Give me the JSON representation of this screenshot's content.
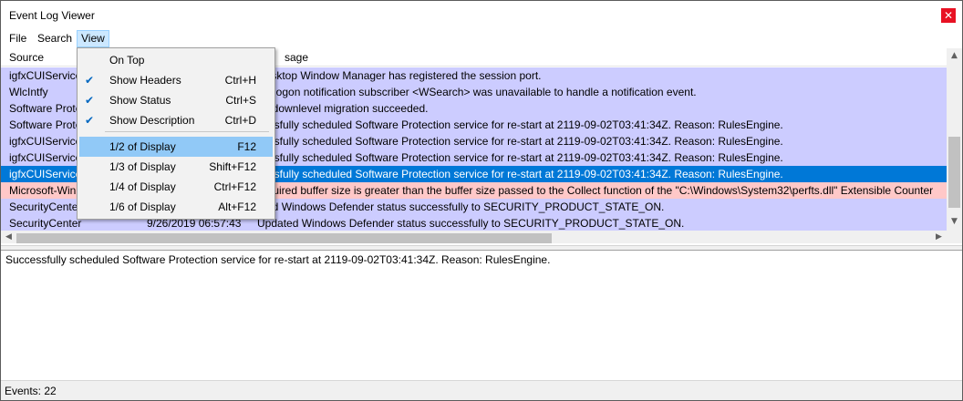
{
  "window": {
    "title": "Event Log Viewer",
    "close_glyph": "✕"
  },
  "menubar": {
    "file": "File",
    "search": "Search",
    "view": "View"
  },
  "columns": {
    "source": "Source",
    "message_partial": "sage"
  },
  "colors": {
    "row_normal": "#ccccff",
    "row_selected": "#0078d7",
    "row_error": "#ffc8c8",
    "row_text_selected": "#ffffff"
  },
  "rows": [
    {
      "source": "igfxCUIService",
      "time": "",
      "message": "Desktop Window Manager has registered the session port.",
      "kind": "normal"
    },
    {
      "source": "WlcIntfy",
      "time": "",
      "message": "winlogon notification subscriber <WSearch> was unavailable to handle a notification event.",
      "kind": "normal"
    },
    {
      "source": "Software Prote",
      "time": "",
      "message": "ne downlevel migration succeeded.",
      "kind": "normal"
    },
    {
      "source": "Software Prote",
      "time": "",
      "message": "cessfully scheduled Software Protection service for re-start at 2119-09-02T03:41:34Z. Reason: RulesEngine.",
      "kind": "normal"
    },
    {
      "source": "igfxCUIService",
      "time": "",
      "message": "cessfully scheduled Software Protection service for re-start at 2119-09-02T03:41:34Z. Reason: RulesEngine.",
      "kind": "normal"
    },
    {
      "source": "igfxCUIService",
      "time": "",
      "message": "cessfully scheduled Software Protection service for re-start at 2119-09-02T03:41:34Z. Reason: RulesEngine.",
      "kind": "normal"
    },
    {
      "source": "igfxCUIService",
      "time": "",
      "message": "cessfully scheduled Software Protection service for re-start at 2119-09-02T03:41:34Z. Reason: RulesEngine.",
      "kind": "selected"
    },
    {
      "source": "Microsoft-Win",
      "time": "",
      "message": "required buffer size is greater than the buffer size passed to the Collect function of the \"C:\\Windows\\System32\\perfts.dll\" Extensible Counter",
      "kind": "error"
    },
    {
      "source": "SecurityCenter",
      "time": "",
      "message": "ated Windows Defender status successfully to SECURITY_PRODUCT_STATE_ON.",
      "kind": "normal"
    },
    {
      "source": "SecurityCenter",
      "time": "9/26/2019 06:57:43",
      "message": "Updated Windows Defender status successfully to SECURITY_PRODUCT_STATE_ON.",
      "kind": "normal"
    }
  ],
  "view_menu": {
    "items": [
      {
        "label": "On Top",
        "shortcut": "",
        "checked": false
      },
      {
        "label": "Show Headers",
        "shortcut": "Ctrl+H",
        "checked": true
      },
      {
        "label": "Show Status",
        "shortcut": "Ctrl+S",
        "checked": true
      },
      {
        "label": "Show Description",
        "shortcut": "Ctrl+D",
        "checked": true
      },
      {
        "label": "1/2 of Display",
        "shortcut": "F12",
        "checked": false,
        "highlighted": true
      },
      {
        "label": "1/3 of Display",
        "shortcut": "Shift+F12",
        "checked": false
      },
      {
        "label": "1/4 of Display",
        "shortcut": "Ctrl+F12",
        "checked": false
      },
      {
        "label": "1/6 of Display",
        "shortcut": "Alt+F12",
        "checked": false
      }
    ],
    "check_glyph": "✔"
  },
  "description": "Successfully scheduled Software Protection service for re-start at 2119-09-02T03:41:34Z. Reason: RulesEngine.",
  "status": {
    "events": "Events: 22"
  },
  "icons": {
    "scroll_up": "▲",
    "scroll_down": "▼",
    "scroll_left": "◀",
    "scroll_right": "▶",
    "grip": "....."
  }
}
